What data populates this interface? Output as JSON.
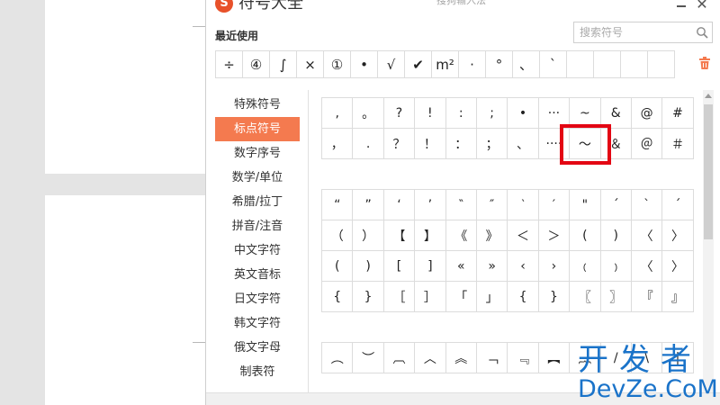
{
  "window": {
    "title": "符号大全",
    "subtitle": "搜狗输入法",
    "logo_glyph": "S",
    "close_glyph": "✕"
  },
  "recent": {
    "label": "最近使用",
    "symbols": [
      "÷",
      "④",
      "∫",
      "×",
      "①",
      "•",
      "√",
      "✔",
      "m²",
      "·",
      "°",
      "、",
      "`",
      "",
      "",
      "",
      ""
    ]
  },
  "search": {
    "placeholder": "搜索符号",
    "value": ""
  },
  "sidebar": {
    "items": [
      {
        "label": "特殊符号",
        "active": false
      },
      {
        "label": "标点符号",
        "active": true
      },
      {
        "label": "数字序号",
        "active": false
      },
      {
        "label": "数学/单位",
        "active": false
      },
      {
        "label": "希腊/拉丁",
        "active": false
      },
      {
        "label": "拼音/注音",
        "active": false
      },
      {
        "label": "中文字符",
        "active": false
      },
      {
        "label": "英文音标",
        "active": false
      },
      {
        "label": "日文字符",
        "active": false
      },
      {
        "label": "韩文字符",
        "active": false
      },
      {
        "label": "俄文字母",
        "active": false
      },
      {
        "label": "制表符",
        "active": false
      }
    ]
  },
  "grids": [
    {
      "rows": [
        [
          ",",
          "。",
          "?",
          "!",
          ":",
          ";",
          "•",
          "···",
          "~",
          "&",
          "@",
          "#"
        ],
        [
          "，",
          ".",
          "？",
          "！",
          "：",
          "；",
          "、",
          "····",
          "～",
          "＆",
          "＠",
          "＃"
        ]
      ]
    },
    {
      "rows": [
        [
          "“",
          "”",
          "‘",
          "’",
          "‶",
          "″",
          "‵",
          "′",
          "\"",
          "ˊ",
          "ˋ",
          "´"
        ],
        [
          "（",
          "）",
          "【",
          "】",
          "《",
          "》",
          "＜",
          "＞",
          "(",
          ")",
          "〈",
          "〉"
        ],
        [
          "(",
          ")",
          "[",
          "]",
          "«",
          "»",
          "‹",
          "›",
          "﹙",
          "﹚",
          "〈",
          "〉"
        ],
        [
          "{",
          "}",
          "［",
          "］",
          "「",
          "」",
          "{",
          "}",
          "〖",
          "〗",
          "『",
          "』"
        ]
      ]
    },
    {
      "rows": [
        [
          "︵",
          "︶",
          "︹",
          "︿",
          "︽",
          "﹁",
          "﹃",
          "︻",
          "︷",
          "/",
          "\\",
          "|"
        ]
      ]
    }
  ],
  "watermark": {
    "cn": "开发者",
    "en": "DevZe.CoM"
  },
  "colors": {
    "accent": "#f47a4f",
    "highlight": "#e30613",
    "watermark": "#1a73c9"
  }
}
